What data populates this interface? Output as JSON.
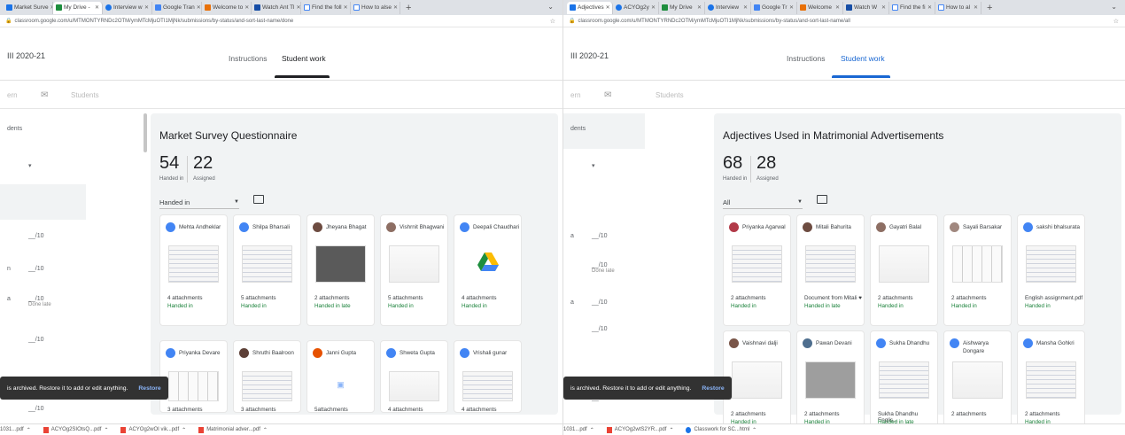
{
  "left": {
    "tabs": [
      "Market Surve",
      "My Drive -",
      "Interview w",
      "Google Tran",
      "Welcome to",
      "Watch Ant Tl",
      "Find the foll",
      "How to alse"
    ],
    "url": "classroom.google.com/u/MTMONTYRNDc2OTM/ymMTcMjuOTI1MjNk/submissions/by-status/and-sort-last-name/done",
    "class_name": "III 2020-21",
    "nav_instructions": "Instructions",
    "nav_student_work": "Student work",
    "sort_label": "Students",
    "sidebar_header": "dents",
    "rows": [
      {
        "name": "",
        "grade": "__/10",
        "sub": ""
      },
      {
        "name": "n",
        "grade": "__/10",
        "sub": ""
      },
      {
        "name": "a",
        "grade": "__/10",
        "sub": "Done late"
      },
      {
        "name": "",
        "grade": "__/10",
        "sub": ""
      },
      {
        "name": "",
        "grade": "__/10",
        "sub": ""
      }
    ],
    "assignment_title": "Market Survey Questionnaire",
    "handed_in_count": "54",
    "handed_in_label": "Handed in",
    "assigned_count": "22",
    "assigned_label": "Assigned",
    "filter": "Handed in",
    "cards": [
      {
        "name": "Mehta Andheklar",
        "att": "4 attachments",
        "status": "Handed in"
      },
      {
        "name": "Shilpa Bharsali",
        "att": "5 attachments",
        "status": "Handed in"
      },
      {
        "name": "Jheyana Bhagat",
        "att": "2 attachments",
        "status": "Handed in late"
      },
      {
        "name": "Vishrnit Bhagwani",
        "att": "5 attachments",
        "status": "Handed in"
      },
      {
        "name": "Deepali Chaudhari",
        "att": "4 attachments",
        "status": "Handed in"
      },
      {
        "name": "Priyanka Devare",
        "att": "3 attachments",
        "status": ""
      },
      {
        "name": "Shruthi Baalroon",
        "att": "3 attachments",
        "status": ""
      },
      {
        "name": "Janni Gupta",
        "att": "5attachments",
        "status": ""
      },
      {
        "name": "Shweta Gupta",
        "att": "4 attachments",
        "status": ""
      },
      {
        "name": "Vrishali gunar",
        "att": "4 attachments",
        "status": ""
      }
    ],
    "snackbar_text": "is archived. Restore it to add or edit anything.",
    "snackbar_action": "Restore",
    "downloads": [
      "1031...pdf",
      "ACYOg2SIOtsQ...pdf",
      "ACYOg2wOI vik...pdf",
      "Matrimonial adver...pdf"
    ]
  },
  "right": {
    "tabs": [
      "Adjectives",
      "ACYOg2y",
      "My Drive",
      "Interview",
      "Google Tr",
      "Welcome",
      "Watch W",
      "Find the fi",
      "How to al"
    ],
    "url": "classroom.google.com/u/MTMONTYRNDc2OTM/ymMTcMjuOTI1MjNk/submissions/by-status/and-sort-last-name/all",
    "class_name": "III 2020-21",
    "nav_instructions": "Instructions",
    "nav_student_work": "Student work",
    "sort_label": "Students",
    "sidebar_header": "dents",
    "rows": [
      {
        "name": "a",
        "grade": "__/10",
        "sub": ""
      },
      {
        "name": "",
        "grade": "__/10",
        "sub": "Done late"
      },
      {
        "name": "a",
        "grade": "__/10",
        "sub": ""
      },
      {
        "name": "",
        "grade": "__/10",
        "sub": ""
      },
      {
        "name": "",
        "grade": "__/10",
        "sub": ""
      }
    ],
    "assignment_title": "Adjectives Used in Matrimonial Advertisements",
    "handed_in_count": "68",
    "handed_in_label": "Handed in",
    "assigned_count": "28",
    "assigned_label": "Assigned",
    "filter": "All",
    "cards": [
      {
        "name": "Priyanka Agarwal",
        "att": "2 attachments",
        "status": "Handed in"
      },
      {
        "name": "Mitali Bahurita",
        "att": "Document from Mitali ♥",
        "status": "Handed in late"
      },
      {
        "name": "Gayatri Balal",
        "att": "2 attachments",
        "status": "Handed in"
      },
      {
        "name": "Sayali Barsakar",
        "att": "2 attachments",
        "status": "Handed in"
      },
      {
        "name": "sakshi bhalsurata",
        "att": "English assignment.pdf",
        "status": "Handed in"
      },
      {
        "name": "Vaishnavi dalji",
        "att": "2 attachments",
        "status": "Handed in"
      },
      {
        "name": "Pawan Devani",
        "att": "2 attachments",
        "status": "Handed in"
      },
      {
        "name": "Sukha Dhandhu",
        "att": "Sukha Dhandhu Englis...",
        "status": "Handed in late"
      },
      {
        "name": "Aishwarya Dongare",
        "att": "2 attachments",
        "status": ""
      },
      {
        "name": "Mansha Gohkri",
        "att": "2 attachments",
        "status": "Handed in"
      }
    ],
    "snackbar_text": "is archived. Restore it to add or edit anything.",
    "snackbar_action": "Restore",
    "downloads": [
      "1031...pdf",
      "ACYOg2wtS2YR...pdf",
      "Classwork for SC...html"
    ]
  },
  "colors": {
    "accent_left": "#202124",
    "accent_right": "#1967d2",
    "handed_in_green": "#188038",
    "tab_strip": "#dee1e6"
  }
}
